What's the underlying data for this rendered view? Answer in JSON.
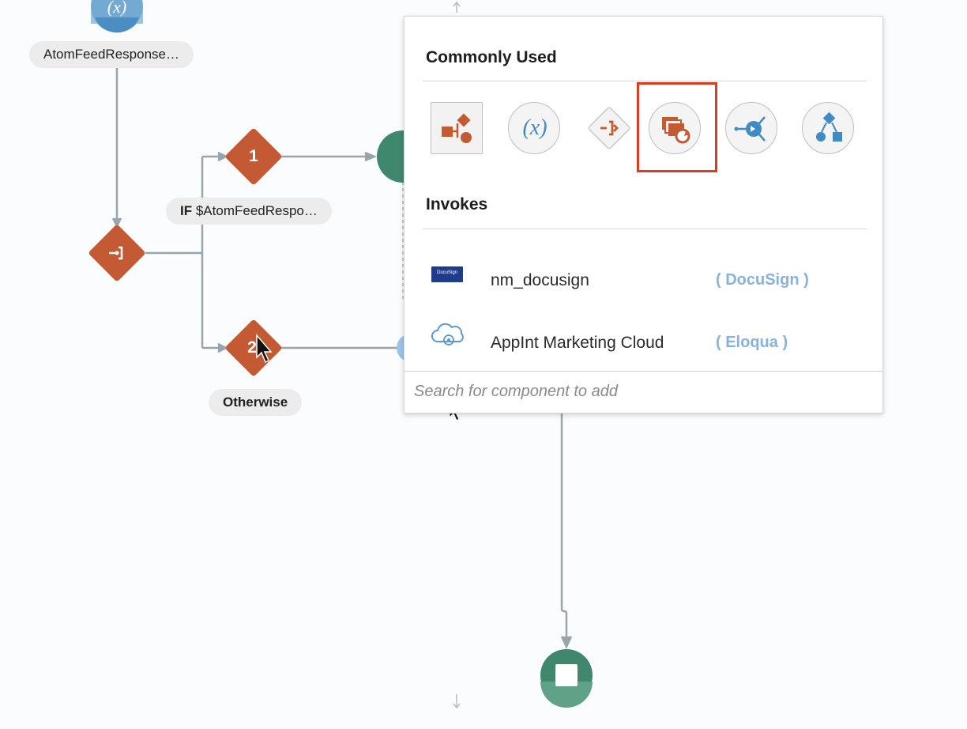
{
  "canvas": {
    "top_node_label": "AtomFeedResponse…",
    "top_node_symbol": "(x)",
    "branch1_label": "1",
    "branch2_label": "2",
    "condition_keyword": "IF",
    "condition_text": "$AtomFeedRespo…",
    "otherwise_label": "Otherwise"
  },
  "panel": {
    "commonly_used_title": "Commonly Used",
    "invokes_title": "Invokes",
    "components": [
      {
        "name": "map-data",
        "icon": "data-mapper-icon"
      },
      {
        "name": "assign",
        "icon": "variable-icon",
        "symbol": "(x)"
      },
      {
        "name": "switch",
        "icon": "switch-icon"
      },
      {
        "name": "for-each",
        "icon": "for-each-icon",
        "selected": true
      },
      {
        "name": "integration",
        "icon": "integration-icon"
      },
      {
        "name": "stage-file",
        "icon": "stage-file-icon"
      }
    ],
    "invokes": [
      {
        "name": "nm_docusign",
        "type": "( DocuSign )",
        "icon": "docusign-logo",
        "logo_text": "DocuSign"
      },
      {
        "name": "AppInt Marketing Cloud",
        "type": "( Eloqua )",
        "icon": "eloqua-cloud-icon"
      }
    ],
    "search": {
      "placeholder": "Search for component to add",
      "value": ""
    }
  },
  "colors": {
    "accent_orange": "#c45a33",
    "teal_node": "#3f876d",
    "variable_blue": "#3e8bc6",
    "highlight_red": "#e03a23",
    "connector_gray": "#9aa4ad",
    "type_link_blue": "#86b3dd"
  }
}
